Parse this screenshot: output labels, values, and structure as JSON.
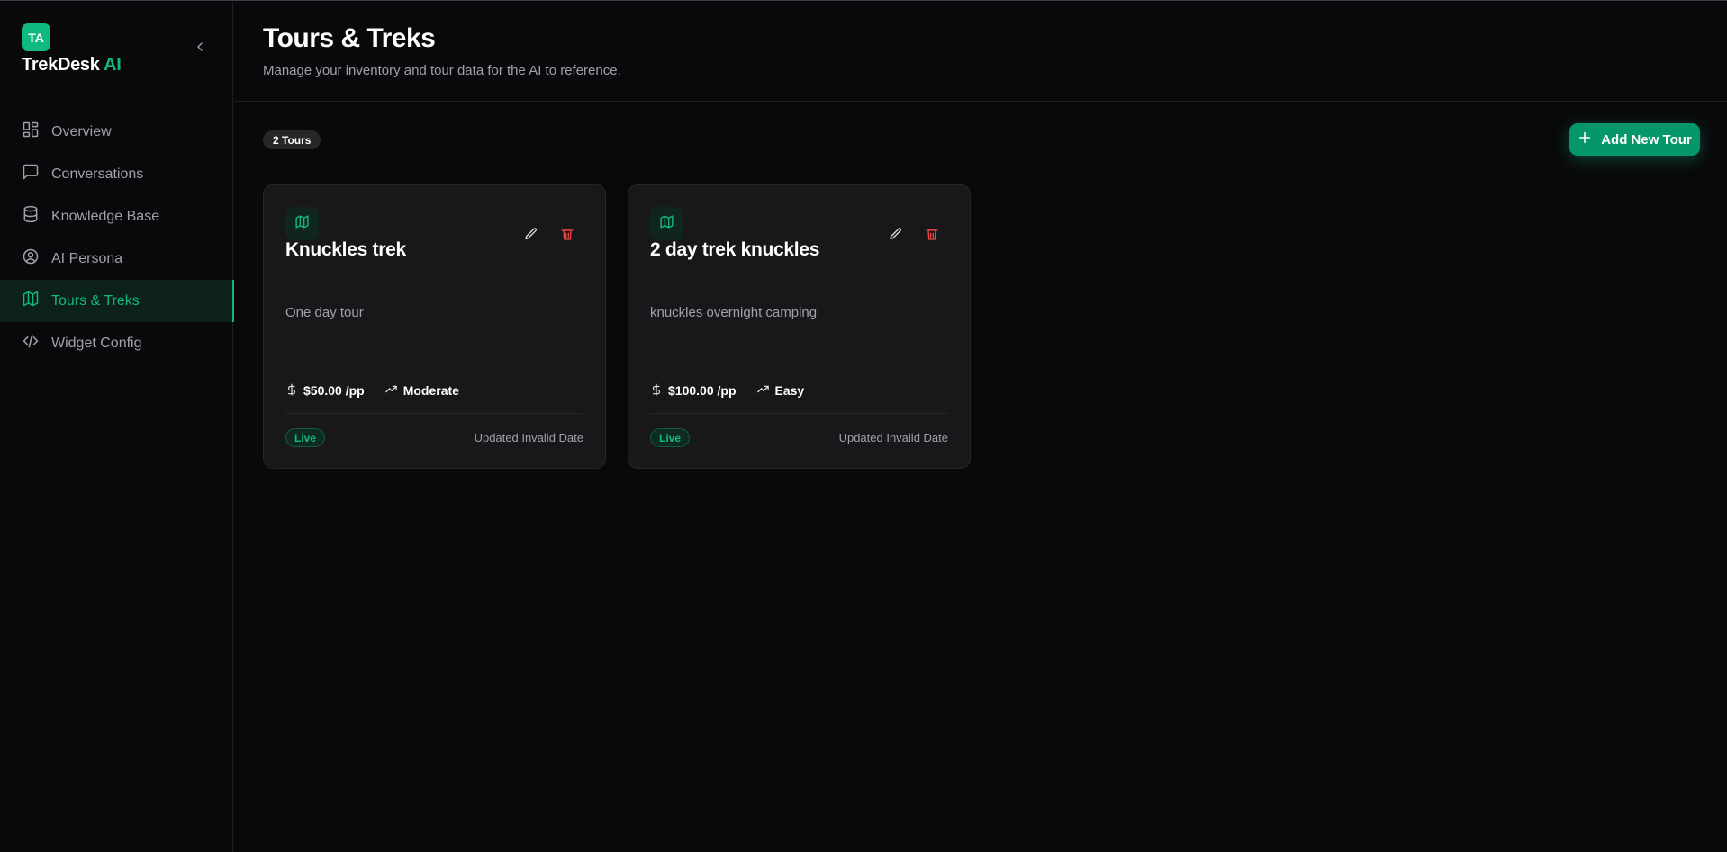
{
  "brand": {
    "badge": "TA",
    "name": "TrekDesk",
    "name_accent": "AI"
  },
  "sidebar": {
    "items": [
      {
        "label": "Overview",
        "icon": "grid-icon",
        "active": false
      },
      {
        "label": "Conversations",
        "icon": "chat-bubble-icon",
        "active": false
      },
      {
        "label": "Knowledge Base",
        "icon": "database-icon",
        "active": false
      },
      {
        "label": "AI Persona",
        "icon": "user-circle-icon",
        "active": false
      },
      {
        "label": "Tours & Treks",
        "icon": "map-icon",
        "active": true
      },
      {
        "label": "Widget Config",
        "icon": "code-icon",
        "active": false
      }
    ]
  },
  "header": {
    "title": "Tours & Treks",
    "subtitle": "Manage your inventory and tour data for the AI to reference."
  },
  "toolbar": {
    "count_label": "2 Tours",
    "add_button_label": "Add New Tour"
  },
  "tours": [
    {
      "title": "Knuckles trek",
      "description": "One day tour",
      "price": "$50.00 /pp",
      "difficulty": "Moderate",
      "status": "Live",
      "updated": "Updated Invalid Date"
    },
    {
      "title": "2 day trek knuckles",
      "description": "knuckles overnight camping",
      "price": "$100.00 /pp",
      "difficulty": "Easy",
      "status": "Live",
      "updated": "Updated Invalid Date"
    }
  ],
  "colors": {
    "accent": "#10b981",
    "background": "#09090b",
    "card": "#18181b",
    "danger": "#ef4444"
  }
}
